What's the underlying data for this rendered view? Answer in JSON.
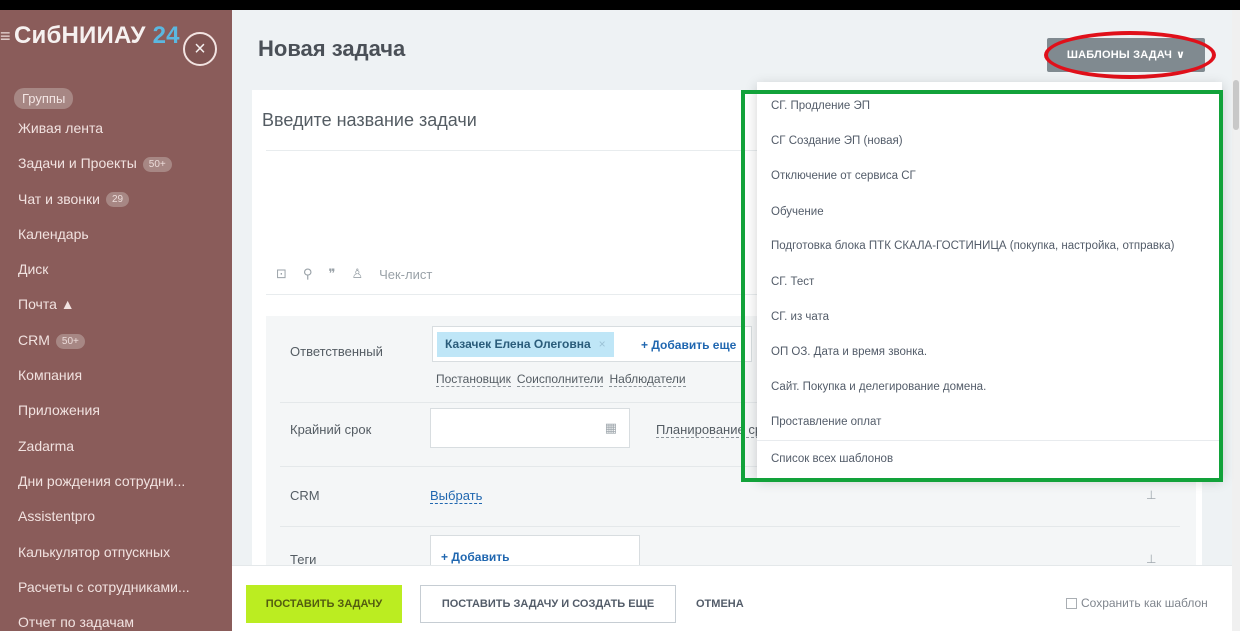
{
  "sidebar": {
    "brand_name": "СибНИИАУ",
    "brand_num": "24",
    "groups_label": "Группы",
    "items": [
      {
        "label": "Живая лента",
        "badge": ""
      },
      {
        "label": "Задачи и Проекты",
        "badge": "50+"
      },
      {
        "label": "Чат и звонки",
        "badge": "29"
      },
      {
        "label": "Календарь",
        "badge": ""
      },
      {
        "label": "Диск",
        "badge": ""
      },
      {
        "label": "Почта ▲",
        "badge": ""
      },
      {
        "label": "CRM",
        "badge": "50+"
      },
      {
        "label": "Компания",
        "badge": ""
      },
      {
        "label": "Приложения",
        "badge": ""
      },
      {
        "label": "Zadarma",
        "badge": ""
      },
      {
        "label": "Дни рождения сотрудни...",
        "badge": ""
      },
      {
        "label": "Assistentpro",
        "badge": ""
      },
      {
        "label": "Калькулятор отпускных",
        "badge": ""
      },
      {
        "label": "Расчеты с сотрудниками...",
        "badge": ""
      },
      {
        "label": "Отчет по задачам",
        "badge": ""
      }
    ]
  },
  "header": {
    "title": "Новая задача",
    "templates_button": "ШАБЛОНЫ ЗАДАЧ"
  },
  "task": {
    "name_placeholder": "Введите название задачи",
    "checklist_label": "Чек-лист"
  },
  "fields": {
    "responsible_label": "Ответственный",
    "responsible_person": "Казачек Елена Олеговна",
    "add_more": "+ Добавить еще",
    "roles": [
      "Постановщик",
      "Соисполнители",
      "Наблюдатели"
    ],
    "deadline_label": "Крайний срок",
    "planning_label": "Планирование сроков",
    "crm_label": "CRM",
    "crm_select": "Выбрать",
    "tags_label": "Теги",
    "tags_add": "+ Добавить"
  },
  "footer": {
    "submit": "ПОСТАВИТЬ ЗАДАЧУ",
    "submit_and_new": "ПОСТАВИТЬ ЗАДАЧУ И СОЗДАТЬ ЕЩЕ",
    "cancel": "ОТМЕНА",
    "save_as_template": "Сохранить как шаблон"
  },
  "templates_dropdown": {
    "items": [
      "СГ. Продление ЭП",
      "СГ Создание ЭП (новая)",
      "Отключение от сервиса СГ",
      "Обучение",
      "Подготовка блока ПТК СКАЛА-ГОСТИНИЦА (покупка, настройка, отправка)",
      "СГ. Тест",
      "СГ. из чата",
      "ОП ОЗ. Дата и время звонка.",
      "Сайт. Покупка и делегирование домена.",
      "Проставление оплат"
    ],
    "all_templates": "Список всех шаблонов"
  },
  "colors": {
    "sidebar_bg": "#8a5c5a",
    "accent_green": "#bbed21",
    "link_blue": "#2067b0",
    "annotation_red": "#e0101a",
    "annotation_green": "#12a23a"
  }
}
